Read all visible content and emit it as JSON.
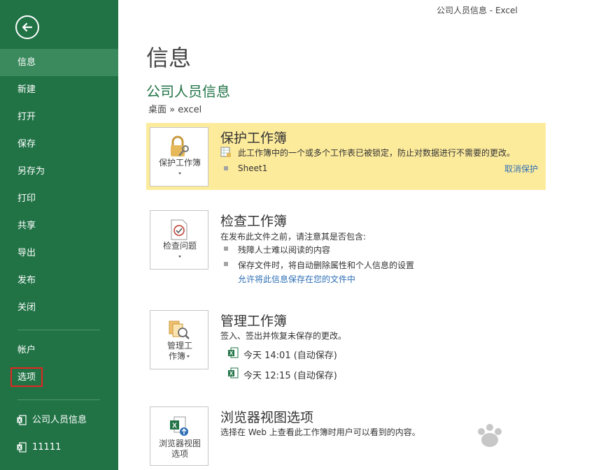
{
  "window": {
    "title": "公司人员信息 - Excel"
  },
  "sidebar": {
    "back_icon": "back-arrow-icon",
    "items": [
      {
        "label": "信息",
        "active": true
      },
      {
        "label": "新建"
      },
      {
        "label": "打开"
      },
      {
        "label": "保存"
      },
      {
        "label": "另存为"
      },
      {
        "label": "打印"
      },
      {
        "label": "共享"
      },
      {
        "label": "导出"
      },
      {
        "label": "发布"
      },
      {
        "label": "关闭"
      },
      {
        "label": "帐户"
      },
      {
        "label": "选项",
        "highlighted": true
      }
    ],
    "recent": [
      {
        "label": "公司人员信息",
        "icon": "excel-file-icon"
      },
      {
        "label": "11111",
        "icon": "excel-file-icon"
      }
    ]
  },
  "main": {
    "page_title": "信息",
    "doc_title": "公司人员信息",
    "doc_path": "桌面 » excel",
    "protect": {
      "tile_label": "保护工作簿",
      "heading": "保护工作簿",
      "description": "此工作簿中的一个或多个工作表已被锁定，防止对数据进行不需要的更改。",
      "sheet": "Sheet1",
      "unprotect_link": "取消保护"
    },
    "inspect": {
      "tile_label": "检查问题",
      "heading": "检查工作簿",
      "description": "在发布此文件之前，请注意其是否包含:",
      "bullets": [
        "残障人士难以阅读的内容",
        "保存文件时，将自动删除属性和个人信息的设置"
      ],
      "link": "允许将此信息保存在您的文件中"
    },
    "manage": {
      "tile_label_line1": "管理工",
      "tile_label_line2": "作簿",
      "heading": "管理工作簿",
      "description": "签入、签出并恢复未保存的更改。",
      "versions": [
        "今天 14:01 (自动保存)",
        "今天 12:15 (自动保存)"
      ]
    },
    "browser": {
      "tile_label_line1": "浏览器视图",
      "tile_label_line2": "选项",
      "heading": "浏览器视图选项",
      "description": "选择在 Web 上查看此工作簿时用户可以看到的内容。"
    }
  },
  "colors": {
    "sidebar": "#217346",
    "active_item": "#3a8a5d",
    "warning_bg": "#fdeb9c",
    "link": "#2e6fb5",
    "highlight_box": "#e3261f"
  }
}
